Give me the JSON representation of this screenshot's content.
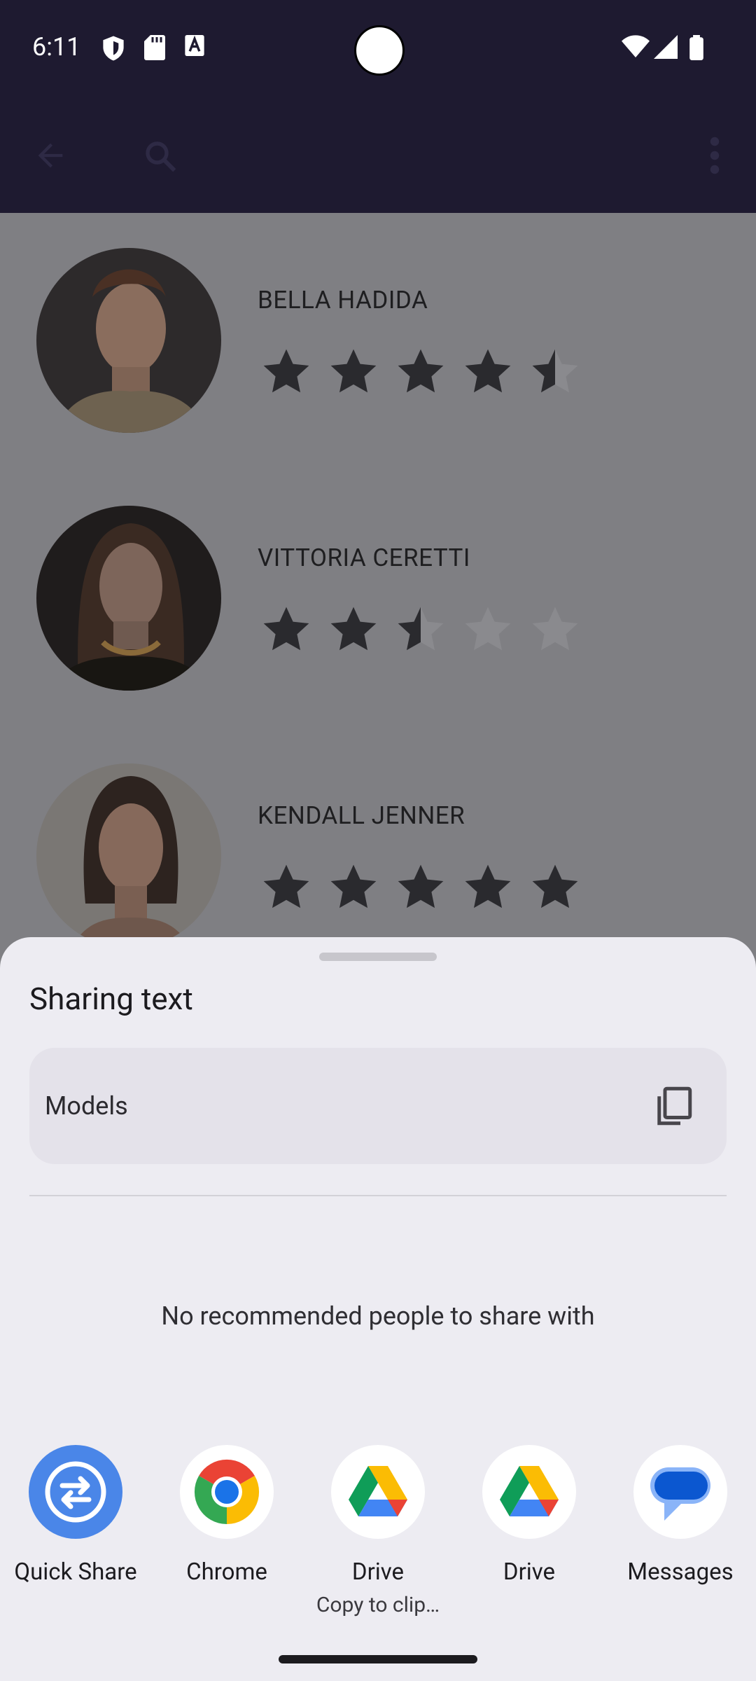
{
  "status_bar": {
    "time": "6:11",
    "icons": [
      "vpn-shield-icon",
      "sd-card-icon",
      "text-a-icon",
      "wifi-icon",
      "signal-icon",
      "battery-icon"
    ]
  },
  "app_bar": {
    "icons": [
      "back-arrow-icon",
      "search-icon",
      "more-vert-icon"
    ]
  },
  "models": [
    {
      "name": "BELLA HADIDA",
      "rating": 4.5
    },
    {
      "name": "VITTORIA CERETTI",
      "rating": 2.5
    },
    {
      "name": "KENDALL JENNER",
      "rating": 5
    }
  ],
  "share_sheet": {
    "title": "Sharing text",
    "shared_text": "Models",
    "empty_people_message": "No recommended people to share with",
    "apps": [
      {
        "label": "Quick Share",
        "icon": "quick-share-icon"
      },
      {
        "label": "Chrome",
        "icon": "chrome-icon"
      },
      {
        "label": "Drive",
        "sublabel": "Copy to clip…",
        "icon": "drive-icon"
      },
      {
        "label": "Drive",
        "icon": "drive-icon"
      },
      {
        "label": "Messages",
        "icon": "messages-icon"
      }
    ]
  },
  "colors": {
    "app_bar": "#1e1a30",
    "scrim_list": "#7f7f83",
    "sheet": "#edecf2",
    "star": "#2a2a2e"
  }
}
